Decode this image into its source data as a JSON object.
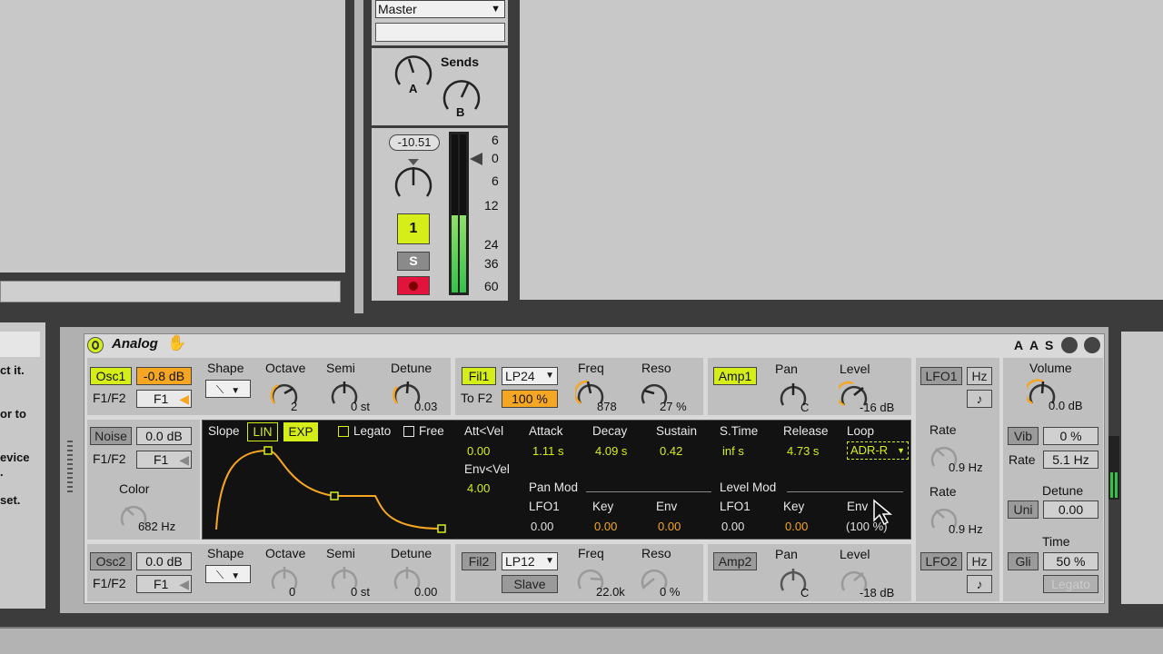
{
  "mixer": {
    "routing": "Master",
    "sends_label": "Sends",
    "send_a": "A",
    "send_b": "B",
    "volume": "-10.51",
    "track_number": "1",
    "solo": "S",
    "meter_scale": [
      "6",
      "0",
      "6",
      "12",
      "24",
      "36",
      "60"
    ]
  },
  "left_panel": {
    "lines": [
      "ct it.",
      "or to",
      "evice",
      ".",
      "set."
    ]
  },
  "device": {
    "name": "Analog",
    "header_buttons": [
      "A",
      "A",
      "S"
    ],
    "osc1": {
      "label": "Osc1",
      "level": "-0.8 dB",
      "route_label": "F1/F2",
      "route": "F1",
      "shape_label": "Shape",
      "octave_label": "Octave",
      "octave": "2",
      "semi_label": "Semi",
      "semi": "0 st",
      "detune_label": "Detune",
      "detune": "0.03"
    },
    "noise": {
      "label": "Noise",
      "level": "0.0 dB",
      "route_label": "F1/F2",
      "route": "F1",
      "color_label": "Color",
      "color": "682 Hz"
    },
    "osc2": {
      "label": "Osc2",
      "level": "0.0 dB",
      "route_label": "F1/F2",
      "route": "F1",
      "shape_label": "Shape",
      "octave_label": "Octave",
      "octave": "0",
      "semi_label": "Semi",
      "semi": "0 st",
      "detune_label": "Detune",
      "detune": "0.00"
    },
    "fil1": {
      "label": "Fil1",
      "type": "LP24",
      "to_label": "To F2",
      "to_value": "100 %",
      "freq_label": "Freq",
      "freq": "878",
      "reso_label": "Reso",
      "reso": "27 %"
    },
    "fil2": {
      "label": "Fil2",
      "type": "LP12",
      "slave": "Slave",
      "freq_label": "Freq",
      "freq": "22.0k",
      "reso_label": "Reso",
      "reso": "0 %"
    },
    "amp1": {
      "label": "Amp1",
      "pan_label": "Pan",
      "pan": "C",
      "level_label": "Level",
      "level": "-16 dB"
    },
    "amp2": {
      "label": "Amp2",
      "pan_label": "Pan",
      "pan": "C",
      "level_label": "Level",
      "level": "-18 dB"
    },
    "envelope": {
      "slope_label": "Slope",
      "lin": "LIN",
      "exp": "EXP",
      "legato": "Legato",
      "free": "Free",
      "att_vel_label": "Att<Vel",
      "att_vel": "0.00",
      "env_vel_label": "Env<Vel",
      "env_vel": "4.00",
      "attack_label": "Attack",
      "attack": "1.11 s",
      "decay_label": "Decay",
      "decay": "4.09 s",
      "sustain_label": "Sustain",
      "sustain": "0.42",
      "stime_label": "S.Time",
      "stime": "inf s",
      "release_label": "Release",
      "release": "4.73 s",
      "loop_label": "Loop",
      "loop": "ADR-R",
      "pan_mod_label": "Pan Mod",
      "level_mod_label": "Level Mod",
      "pm_lfo_label": "LFO1",
      "pm_lfo": "0.00",
      "pm_key_label": "Key",
      "pm_key": "0.00",
      "pm_env_label": "Env",
      "pm_env": "0.00",
      "lm_lfo_label": "LFO1",
      "lm_lfo": "0.00",
      "lm_key_label": "Key",
      "lm_key": "0.00",
      "lm_env_label": "Env",
      "lm_env": "(100 %)"
    },
    "lfo1": {
      "label": "LFO1",
      "hz": "Hz",
      "rate_label": "Rate",
      "rate": "0.9 Hz"
    },
    "lfo2": {
      "label": "LFO2",
      "hz": "Hz",
      "rate_label": "Rate",
      "rate": "0.9 Hz"
    },
    "global": {
      "volume_label": "Volume",
      "volume": "0.0 dB",
      "vib": "Vib",
      "vib_value": "0 %",
      "rate_label": "Rate",
      "rate": "5.1 Hz",
      "detune_label": "Detune",
      "uni": "Uni",
      "detune": "0.00",
      "time_label": "Time",
      "gli": "Gli",
      "time": "50 %",
      "legato": "Legato"
    }
  },
  "colors": {
    "accent": "#d5ee1a",
    "orange": "#f5a623",
    "display_bg": "#121212"
  }
}
